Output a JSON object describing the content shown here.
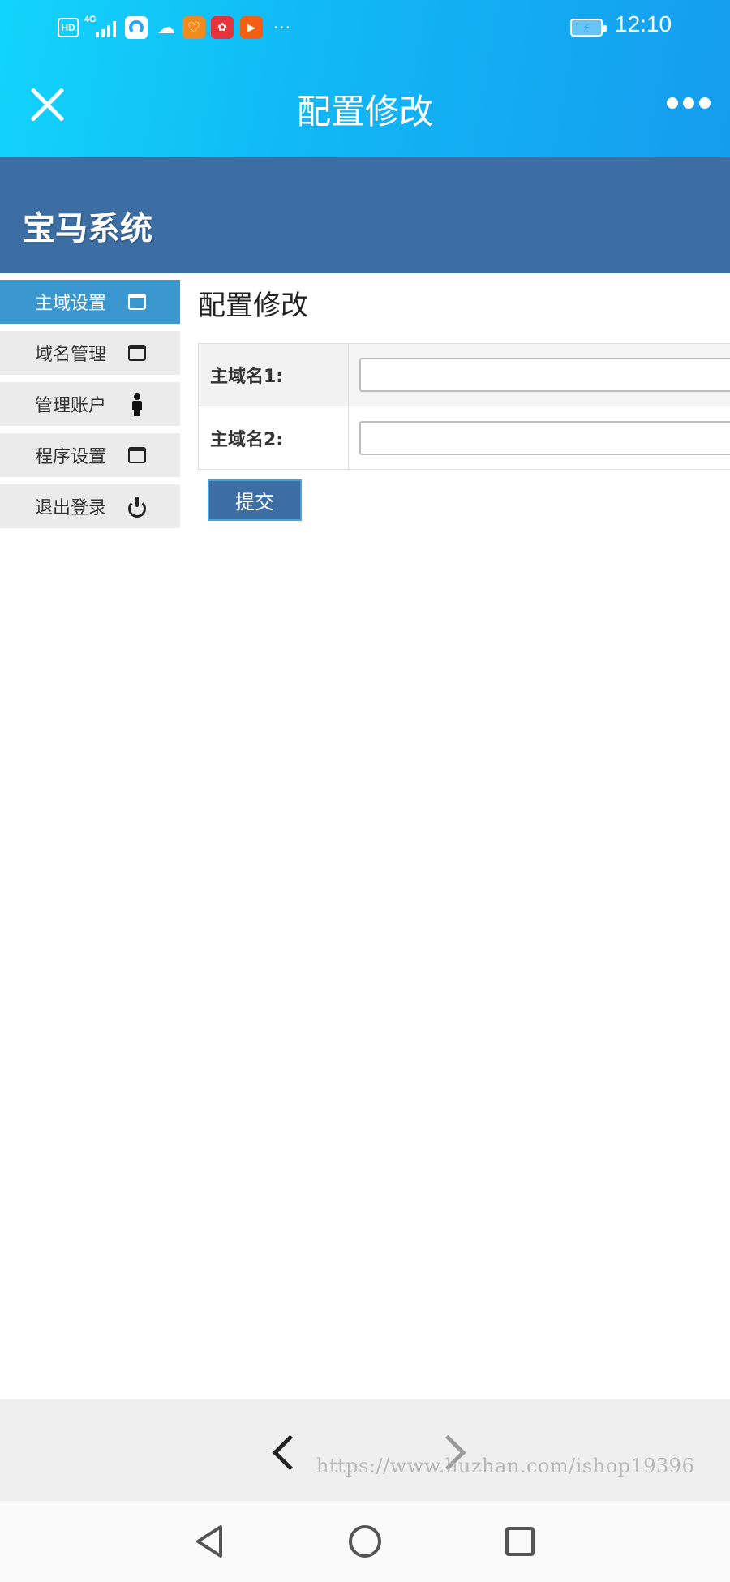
{
  "status_bar": {
    "hd_label": "HD",
    "network_label": "4G",
    "more_label": "···",
    "time": "12:10"
  },
  "title_bar": {
    "title": "配置修改"
  },
  "app": {
    "title": "宝马系统"
  },
  "sidebar": {
    "items": [
      {
        "label": "主域设置",
        "icon": "window-icon",
        "active": true
      },
      {
        "label": "域名管理",
        "icon": "window-icon",
        "active": false
      },
      {
        "label": "管理账户",
        "icon": "person-icon",
        "active": false
      },
      {
        "label": "程序设置",
        "icon": "window-icon",
        "active": false
      },
      {
        "label": "退出登录",
        "icon": "power-icon",
        "active": false
      }
    ]
  },
  "main": {
    "title": "配置修改",
    "fields": [
      {
        "label": "主域名1:",
        "value": "",
        "placeholder": ""
      },
      {
        "label": "主域名2:",
        "value": "",
        "placeholder": ""
      }
    ],
    "submit_label": "提交"
  },
  "browser_nav": {
    "watermark": "https://www.huzhan.com/ishop19396"
  },
  "colors": {
    "header_blue": "#3c6ea4",
    "active_tab": "#3a97cf",
    "titlebar_gradient_start": "#12d4fb",
    "titlebar_gradient_end": "#169cee"
  }
}
